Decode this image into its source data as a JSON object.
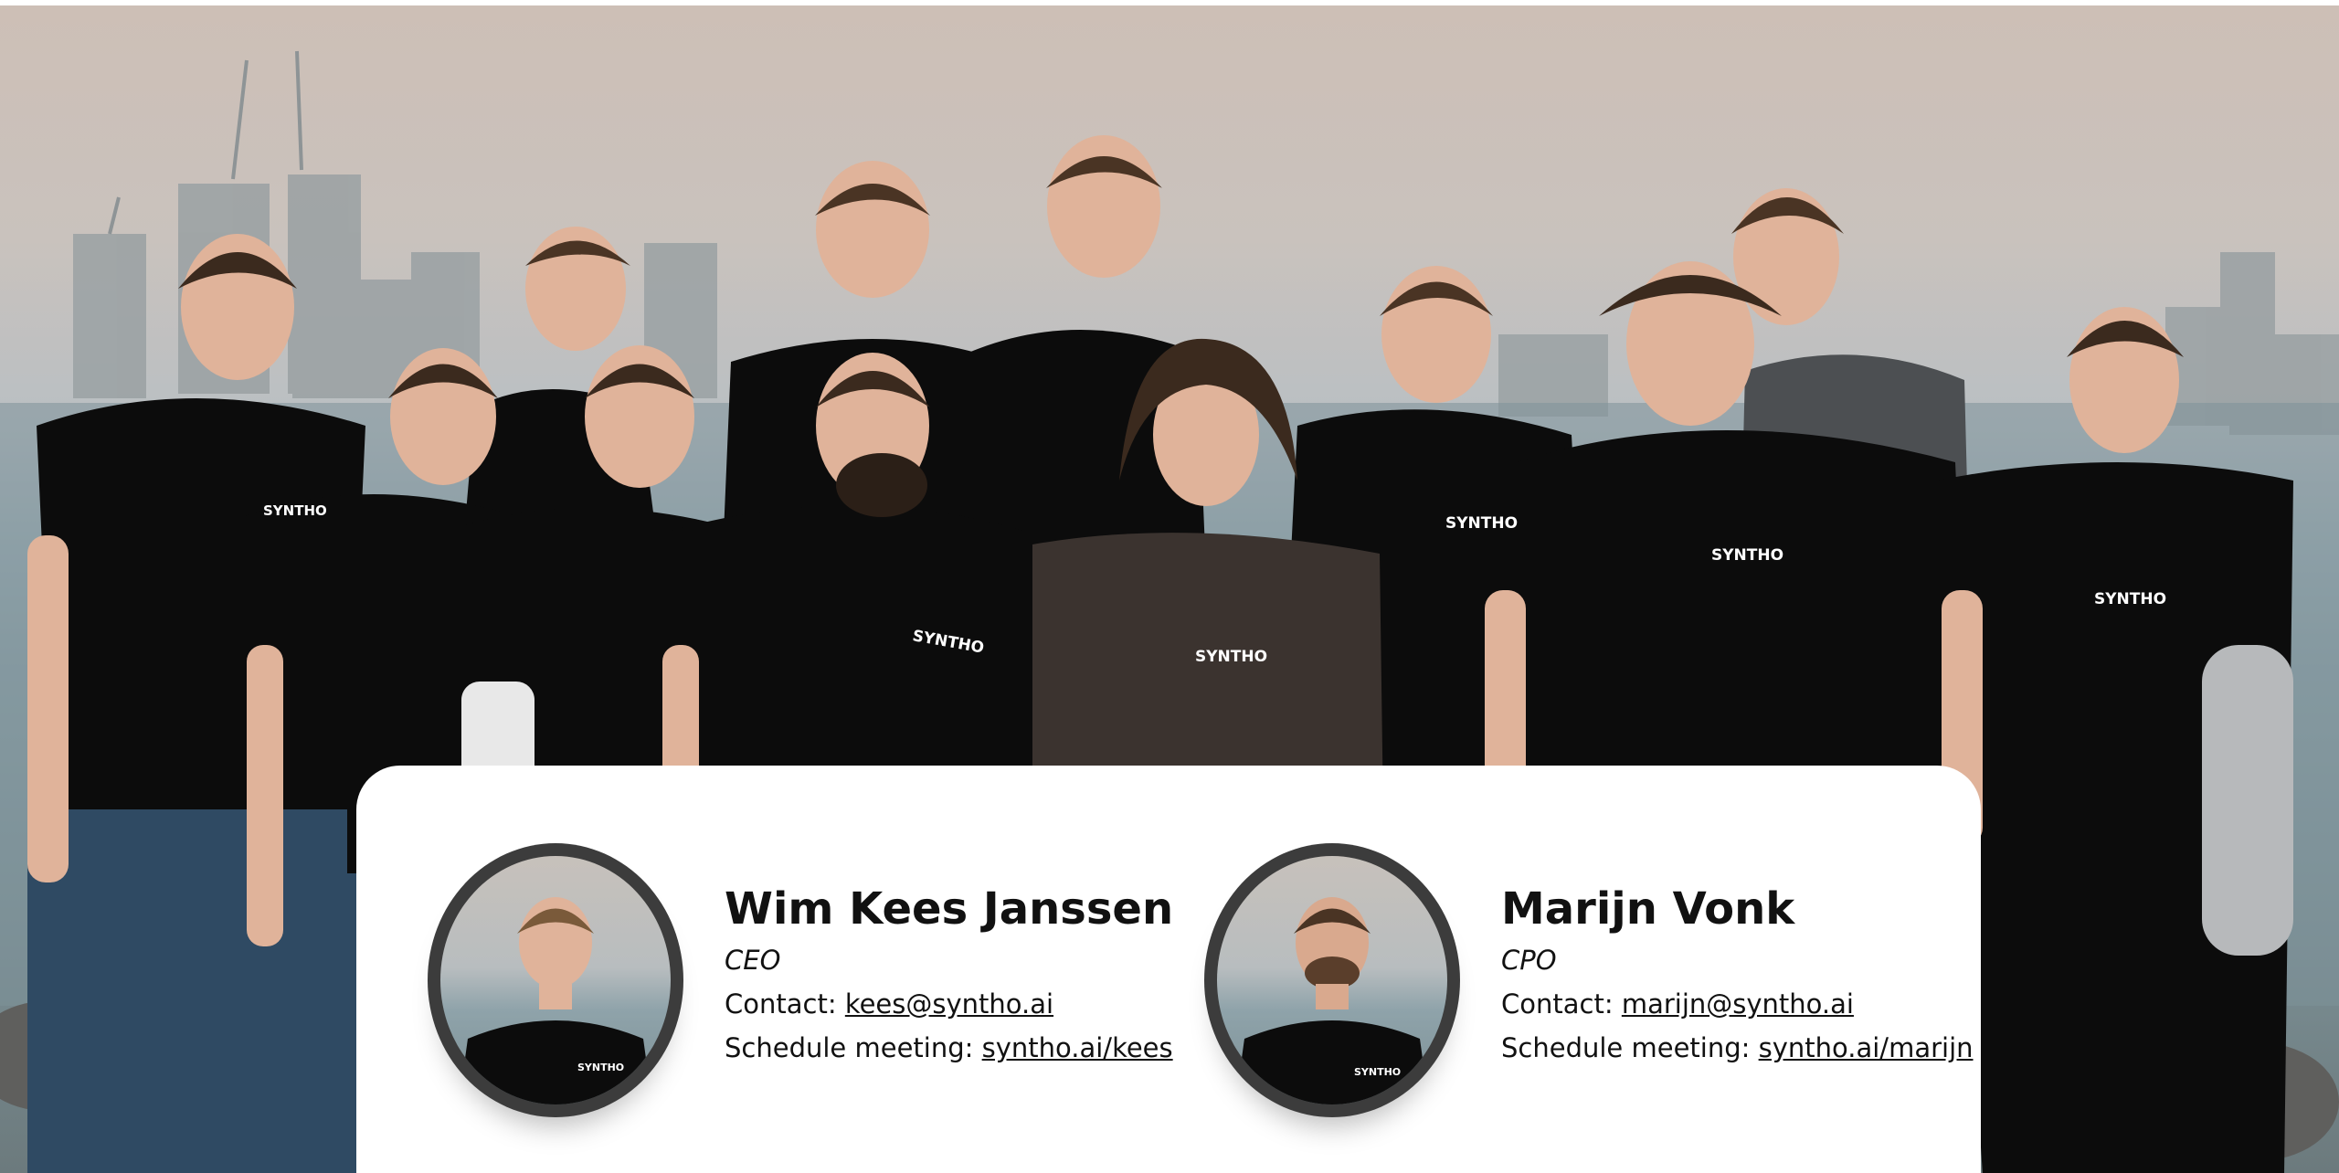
{
  "hero": {
    "shirt_brand": "SYNTHO"
  },
  "contacts": [
    {
      "name": "Wim Kees Janssen",
      "role": "CEO",
      "contact_label": "Contact: ",
      "email": "kees@syntho.ai",
      "meeting_label": "Schedule meeting: ",
      "meeting_link": "syntho.ai/kees"
    },
    {
      "name": "Marijn Vonk",
      "role": "CPO",
      "contact_label": "Contact: ",
      "email": "marijn@syntho.ai",
      "meeting_label": "Schedule meeting: ",
      "meeting_link": "syntho.ai/marijn"
    }
  ],
  "colors": {
    "card_bg": "#ffffff",
    "avatar_ring": "#3c3c3c",
    "text": "#111111",
    "shirt": "#0c0c0c"
  }
}
